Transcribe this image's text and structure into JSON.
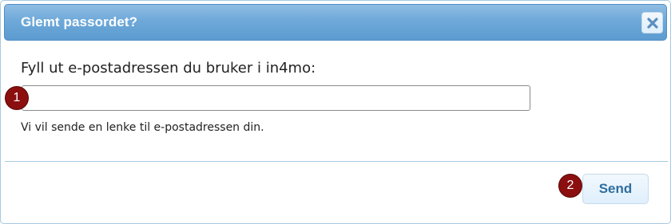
{
  "dialog": {
    "title": "Glemt passordet?",
    "close_icon": "close-icon",
    "prompt": "Fyll ut e-postadressen du bruker i in4mo:",
    "email_input": {
      "value": "",
      "placeholder": ""
    },
    "hint": "Vi vil sende en lenke til e-postadressen din.",
    "send_label": "Send"
  },
  "markers": [
    "1",
    "2"
  ],
  "colors": {
    "titlebar": "#6ea9d9",
    "accent_text": "#2e6e9e",
    "marker": "#8b0f0f",
    "border": "#a6c9e2"
  }
}
